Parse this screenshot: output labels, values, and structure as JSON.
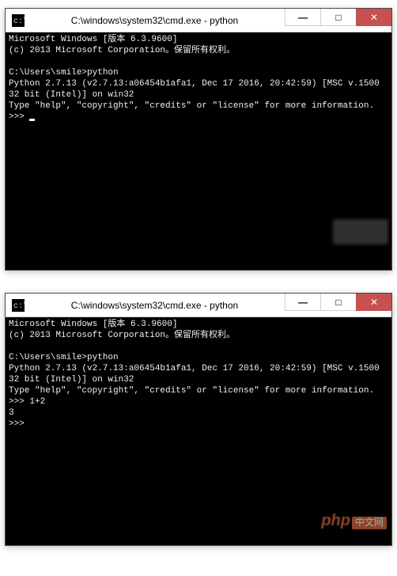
{
  "window1": {
    "title": "C:\\windows\\system32\\cmd.exe - python",
    "lines": [
      "Microsoft Windows [版本 6.3.9600]",
      "(c) 2013 Microsoft Corporation。保留所有权利。",
      "",
      "C:\\Users\\smile>python",
      "Python 2.7.13 (v2.7.13:a06454b1afa1, Dec 17 2016, 20:42:59) [MSC v.1500 32 bit (Intel)] on win32",
      "Type \"help\", \"copyright\", \"credits\" or \"license\" for more information.",
      ">>> "
    ]
  },
  "window2": {
    "title": "C:\\windows\\system32\\cmd.exe - python",
    "lines": [
      "Microsoft Windows [版本 6.3.9600]",
      "(c) 2013 Microsoft Corporation。保留所有权利。",
      "",
      "C:\\Users\\smile>python",
      "Python 2.7.13 (v2.7.13:a06454b1afa1, Dec 17 2016, 20:42:59) [MSC v.1500 32 bit (Intel)] on win32",
      "Type \"help\", \"copyright\", \"credits\" or \"license\" for more information.",
      ">>> 1+2",
      "3",
      ">>>"
    ]
  },
  "controls": {
    "min": "—",
    "max": "□",
    "close": "✕"
  },
  "watermark": {
    "text": "php",
    "suffix": "中文网"
  }
}
